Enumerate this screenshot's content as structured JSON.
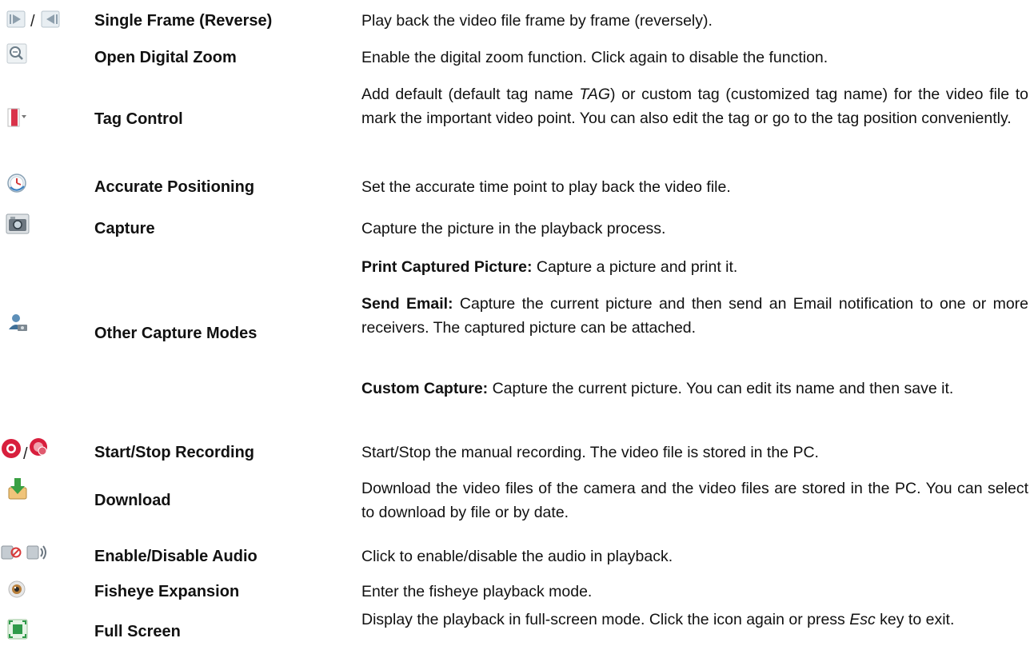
{
  "rows": [
    {
      "icon": "single-frame-forward-reverse-icon",
      "name": "Single Frame (Reverse)",
      "desc": "Play back the video file frame by frame (reversely)."
    },
    {
      "icon": "digital-zoom-icon",
      "name": "Open Digital Zoom",
      "desc": "Enable the digital zoom function. Click again to disable the function."
    },
    {
      "icon": "tag-icon",
      "name": "Tag Control",
      "desc_pre": "Add default (default tag name ",
      "desc_em": "TAG",
      "desc_post": ") or custom tag (customized tag name) for the video file to mark the important video point. You can also edit the tag or go to the tag position conveniently."
    },
    {
      "icon": "accurate-positioning-clock-icon",
      "name": "Accurate Positioning",
      "desc": "Set the accurate time point to play back the video file."
    },
    {
      "icon": "camera-capture-icon",
      "name": "Capture",
      "desc": "Capture the picture in the playback process."
    },
    {
      "icon": "other-capture-modes-icon",
      "name": "Other Capture Modes",
      "items": [
        {
          "label": "Print Captured Picture:",
          "text": " Capture a picture and print it."
        },
        {
          "label": "Send Email:",
          "text": " Capture the current picture and then send an Email notification to one or more receivers. The captured picture can be attached."
        },
        {
          "label": "Custom Capture:",
          "text": " Capture the current picture. You can edit its name and then save it."
        }
      ]
    },
    {
      "icon": "start-stop-recording-icon",
      "name": "Start/Stop Recording",
      "desc": "Start/Stop the manual recording. The video file is stored in the PC."
    },
    {
      "icon": "download-icon",
      "name": "Download",
      "desc": "Download the video files of the camera and the video files are stored in the PC. You can select to download by file or by date."
    },
    {
      "icon": "enable-disable-audio-icon",
      "name": "Enable/Disable Audio",
      "desc": "Click to enable/disable the audio in playback."
    },
    {
      "icon": "fisheye-expansion-icon",
      "name": "Fisheye Expansion",
      "desc": "Enter the fisheye playback mode."
    },
    {
      "icon": "full-screen-icon",
      "name": "Full Screen",
      "desc_pre": "Display the playback in full-screen mode. Click the icon again or press ",
      "desc_em": "Esc",
      "desc_post": " key to exit."
    }
  ]
}
